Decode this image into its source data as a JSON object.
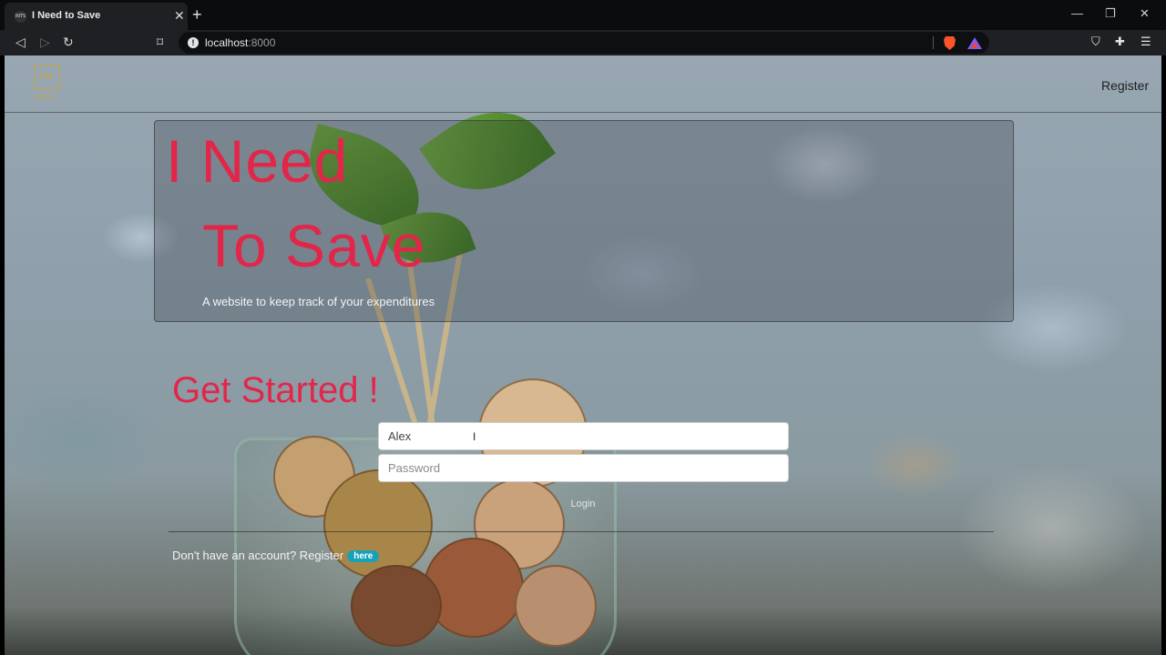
{
  "browser": {
    "tab_title": "I Need to Save",
    "tab_favicon_text": "INTS",
    "url_host": "localhost",
    "url_port": ":8000"
  },
  "site": {
    "logo_text": "IN",
    "logo_sub": "INTS",
    "nav_register": "Register"
  },
  "hero": {
    "line1": "I Need",
    "line2": "To Save",
    "subtitle": "A website to keep track of your expenditures"
  },
  "login": {
    "heading": "Get Started !",
    "username_value": "Alex",
    "password_placeholder": "Password",
    "login_label": "Login",
    "register_prompt": "Don't have an account? Register",
    "here_label": "here"
  },
  "colors": {
    "accent": "#e2264a",
    "badge": "#17a2b8",
    "logo": "#c9a340"
  }
}
